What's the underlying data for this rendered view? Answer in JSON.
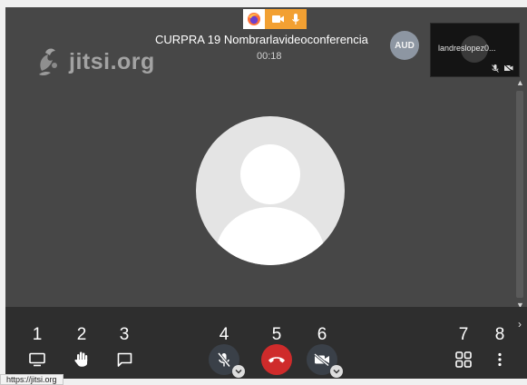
{
  "logo": {
    "text": "jitsi.org",
    "icon": "jitsi-logo-icon"
  },
  "browser_indicator": {
    "icons": [
      "firefox-icon",
      "camera-icon",
      "microphone-icon"
    ],
    "accent": "#f2a032"
  },
  "meeting": {
    "subject": "CURPRA 19 Nombrarlavideoconferencia",
    "timer": "00:18"
  },
  "participant_badge": "AUD",
  "thumbnail": {
    "name": "landreslopez0...",
    "icons": [
      "mic-muted-icon",
      "camera-off-icon"
    ]
  },
  "toolbar": {
    "numbers": [
      "1",
      "2",
      "3",
      "4",
      "5",
      "6",
      "7",
      "8"
    ],
    "buttons": [
      {
        "name": "screen-share-icon"
      },
      {
        "name": "raise-hand-icon"
      },
      {
        "name": "chat-icon"
      },
      {
        "name": "mic-muted-icon"
      },
      {
        "name": "hangup-icon"
      },
      {
        "name": "camera-off-icon"
      },
      {
        "name": "tile-view-icon"
      },
      {
        "name": "more-options-icon"
      }
    ],
    "colors": {
      "hangup": "#cf2b2b",
      "bar": "#2e2e2e"
    }
  },
  "status_bar": {
    "url": "https://jitsi.org"
  }
}
